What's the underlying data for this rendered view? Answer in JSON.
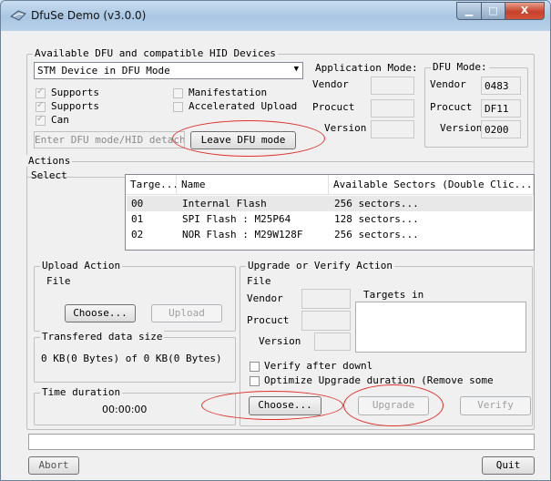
{
  "window": {
    "title": "DfuSe Demo (v3.0.0)",
    "min_glyph": "▁",
    "max_glyph": "□",
    "close_glyph": "X"
  },
  "devices": {
    "group_label": "Available DFU and compatible HID Devices",
    "selected": "STM Device in DFU Mode",
    "supports1": "Supports",
    "supports2": "Supports",
    "can": "Can",
    "manifestation": "Manifestation",
    "accelerated_upload": "Accelerated Upload",
    "enter_dfu_text": "Enter DFU mode/HID detach",
    "leave_dfu_button": "Leave DFU mode",
    "app_mode": {
      "label": "Application Mode:",
      "vendor_label": "Vendor",
      "procuct_label": "Procuct",
      "version_label": "Version",
      "vendor": "",
      "procuct": "",
      "version": ""
    },
    "dfu_mode": {
      "label": "DFU Mode:",
      "vendor_label": "Vendor",
      "procuct_label": "Procuct",
      "version_label": "Version",
      "vendor": "0483",
      "procuct": "DF11",
      "version": "0200"
    }
  },
  "actions": {
    "group_label": "Actions",
    "select_label": "Select",
    "columns": [
      "Targe...",
      "Name",
      "Available Sectors (Double Clic..."
    ],
    "rows": [
      {
        "target": "00",
        "name": "Internal Flash",
        "sectors": "256 sectors..."
      },
      {
        "target": "01",
        "name": "SPI Flash : M25P64",
        "sectors": "128 sectors..."
      },
      {
        "target": "02",
        "name": "NOR Flash : M29W128F",
        "sectors": "256 sectors..."
      }
    ]
  },
  "upload": {
    "group_label": "Upload Action",
    "file_label": "File",
    "choose_button": "Choose...",
    "upload_button": "Upload"
  },
  "transfer": {
    "group_label": "Transfered data size",
    "text": "0 KB(0 Bytes) of 0 KB(0 Bytes)"
  },
  "time": {
    "group_label": "Time duration",
    "value": "00:00:00"
  },
  "upgrade": {
    "group_label": "Upgrade or Verify Action",
    "file_label": "File",
    "vendor_label": "Vendor",
    "procuct_label": "Procuct",
    "version_label": "Version",
    "targets_label": "Targets in",
    "verify_after": "Verify after downl",
    "optimize": "Optimize Upgrade duration (Remove some",
    "choose_button": "Choose...",
    "upgrade_button": "Upgrade",
    "verify_button": "Verify"
  },
  "bottom": {
    "abort_button": "Abort",
    "quit_button": "Quit"
  },
  "colors": {
    "annotation": "#e0302a",
    "title_gradient_top": "#c8dcf0",
    "close_red": "#c7402a"
  }
}
